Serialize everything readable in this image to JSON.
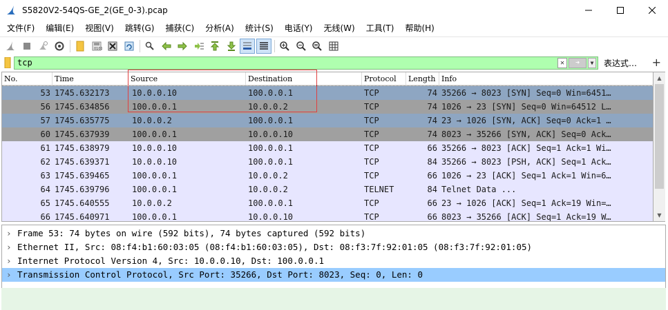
{
  "window": {
    "title": "S5820V2-54QS-GE_2(GE_0-3).pcap"
  },
  "menu": [
    "文件(F)",
    "编辑(E)",
    "视图(V)",
    "跳转(G)",
    "捕获(C)",
    "分析(A)",
    "统计(S)",
    "电话(Y)",
    "无线(W)",
    "工具(T)",
    "帮助(H)"
  ],
  "filter": {
    "value": "tcp",
    "expression_label": "表达式…",
    "plus": "+"
  },
  "columns": [
    "No.",
    "Time",
    "Source",
    "Destination",
    "Protocol",
    "Length",
    "Info"
  ],
  "packets": [
    {
      "no": "53",
      "time": "1745.632173",
      "src": "10.0.0.10",
      "dst": "100.0.0.1",
      "proto": "TCP",
      "len": "74",
      "info": "35266 → 8023 [SYN] Seq=0 Win=6451…"
    },
    {
      "no": "56",
      "time": "1745.634856",
      "src": "100.0.0.1",
      "dst": "10.0.0.2",
      "proto": "TCP",
      "len": "74",
      "info": "1026 → 23 [SYN] Seq=0 Win=64512 L…"
    },
    {
      "no": "57",
      "time": "1745.635775",
      "src": "10.0.0.2",
      "dst": "100.0.0.1",
      "proto": "TCP",
      "len": "74",
      "info": "23 → 1026 [SYN, ACK] Seq=0 Ack=1 …"
    },
    {
      "no": "60",
      "time": "1745.637939",
      "src": "100.0.0.1",
      "dst": "10.0.0.10",
      "proto": "TCP",
      "len": "74",
      "info": "8023 → 35266 [SYN, ACK] Seq=0 Ack…"
    },
    {
      "no": "61",
      "time": "1745.638979",
      "src": "10.0.0.10",
      "dst": "100.0.0.1",
      "proto": "TCP",
      "len": "66",
      "info": "35266 → 8023 [ACK] Seq=1 Ack=1 Wi…"
    },
    {
      "no": "62",
      "time": "1745.639371",
      "src": "10.0.0.10",
      "dst": "100.0.0.1",
      "proto": "TCP",
      "len": "84",
      "info": "35266 → 8023 [PSH, ACK] Seq=1 Ack…"
    },
    {
      "no": "63",
      "time": "1745.639465",
      "src": "100.0.0.1",
      "dst": "10.0.0.2",
      "proto": "TCP",
      "len": "66",
      "info": "1026 → 23 [ACK] Seq=1 Ack=1 Win=6…"
    },
    {
      "no": "64",
      "time": "1745.639796",
      "src": "100.0.0.1",
      "dst": "10.0.0.2",
      "proto": "TELNET",
      "len": "84",
      "info": "Telnet Data ..."
    },
    {
      "no": "65",
      "time": "1745.640555",
      "src": "10.0.0.2",
      "dst": "100.0.0.1",
      "proto": "TCP",
      "len": "66",
      "info": "23 → 1026 [ACK] Seq=1 Ack=19 Win=…"
    },
    {
      "no": "66",
      "time": "1745.640971",
      "src": "100.0.0.1",
      "dst": "10.0.0.10",
      "proto": "TCP",
      "len": "66",
      "info": "8023 → 35266 [ACK] Seq=1 Ack=19 W…"
    }
  ],
  "details": [
    "Frame 53: 74 bytes on wire (592 bits), 74 bytes captured (592 bits)",
    "Ethernet II, Src: 08:f4:b1:60:03:05 (08:f4:b1:60:03:05), Dst: 08:f3:7f:92:01:05 (08:f3:7f:92:01:05)",
    "Internet Protocol Version 4, Src: 10.0.0.10, Dst: 100.0.0.1",
    "Transmission Control Protocol, Src Port: 35266, Dst Port: 8023, Seq: 0, Len: 0"
  ],
  "colors": {
    "syn_row": "#8ea6c2",
    "syn_row_gray": "#a0a0a0",
    "normal_row": "#e7e6ff",
    "detail_selected": "#99ccff",
    "filter_ok": "#afffaf",
    "highlight_box": "#e04040"
  }
}
